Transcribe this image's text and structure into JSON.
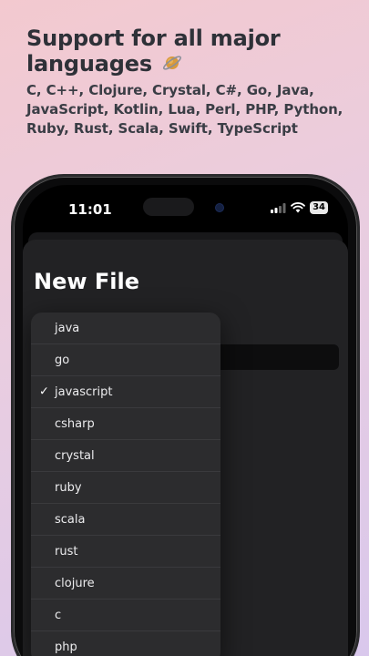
{
  "promo": {
    "title_line1": "Support for all major",
    "title_line2": "languages",
    "subtitle": "C, C++, Clojure, Crystal, C#, Go, Java, JavaScript, Kotlin, Lua, Perl, PHP, Python, Ruby, Rust, Scala, Swift, TypeScript"
  },
  "status_bar": {
    "time": "11:01",
    "battery": "34",
    "icons": [
      "cellular-signal-icon",
      "wifi-icon",
      "battery-icon"
    ]
  },
  "sheet": {
    "title": "New File"
  },
  "language_menu": {
    "selected": "javascript",
    "check_mark": "✓",
    "items": [
      "java",
      "go",
      "javascript",
      "csharp",
      "crystal",
      "ruby",
      "scala",
      "rust",
      "clojure",
      "c",
      "php"
    ]
  },
  "colors": {
    "background_start": "#f3c9cf",
    "background_end": "#d9c8ec",
    "menu_bg": "#2c2c2e",
    "sheet_bg": "#222224"
  }
}
